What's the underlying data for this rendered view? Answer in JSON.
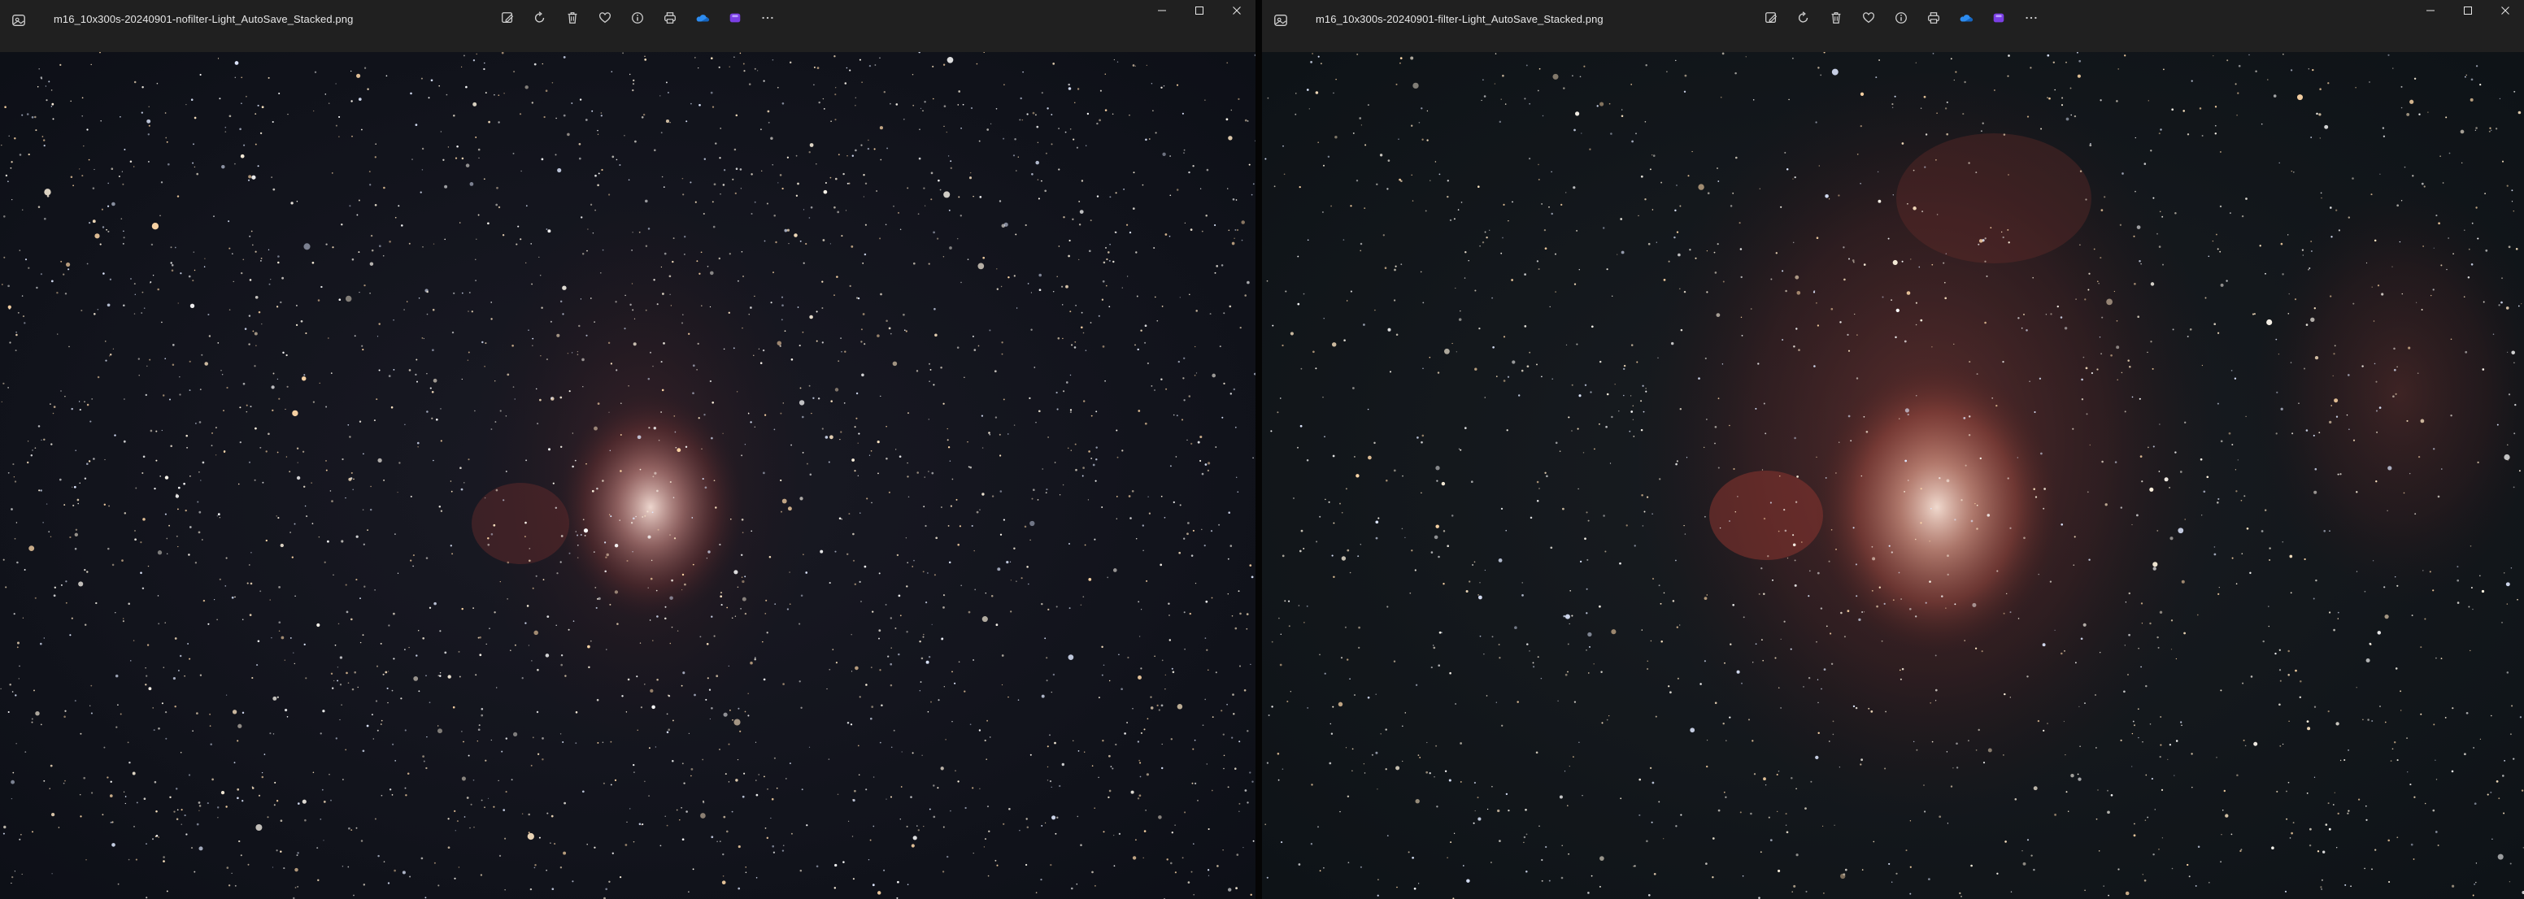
{
  "colors": {
    "window_bg": "#202020",
    "title_text": "#e6e6e6",
    "icon_color": "#d0d0d0",
    "onedrive_blue": "#2d8cf0",
    "clipchamp_purple": "#7b3fe4",
    "nebula_core": "#f3d6cf",
    "nebula_glow": "#9b3f3a",
    "sky": "#0f141c"
  },
  "windows": [
    {
      "app_icon": "photos-app-icon",
      "file_name": "m16_10x300s-20240901-nofilter-Light_AutoSave_Stacked.png",
      "image_description": "Eagle Nebula (M16) star field without filter"
    },
    {
      "app_icon": "photos-app-icon",
      "file_name": "m16_10x300s-20240901-filter-Light_AutoSave_Stacked.png",
      "image_description": "Eagle Nebula (M16) star field with filter"
    }
  ],
  "toolbar": [
    {
      "icon": "edit-image-icon"
    },
    {
      "icon": "rotate-icon"
    },
    {
      "icon": "delete-icon"
    },
    {
      "icon": "favorite-heart-icon"
    },
    {
      "icon": "file-info-icon"
    },
    {
      "icon": "print-icon"
    },
    {
      "icon": "onedrive-cloud-icon"
    },
    {
      "icon": "clipchamp-icon"
    },
    {
      "icon": "more-options-icon"
    }
  ],
  "caption_buttons": [
    {
      "icon": "minimize-icon"
    },
    {
      "icon": "maximize-icon"
    },
    {
      "icon": "close-icon"
    }
  ]
}
